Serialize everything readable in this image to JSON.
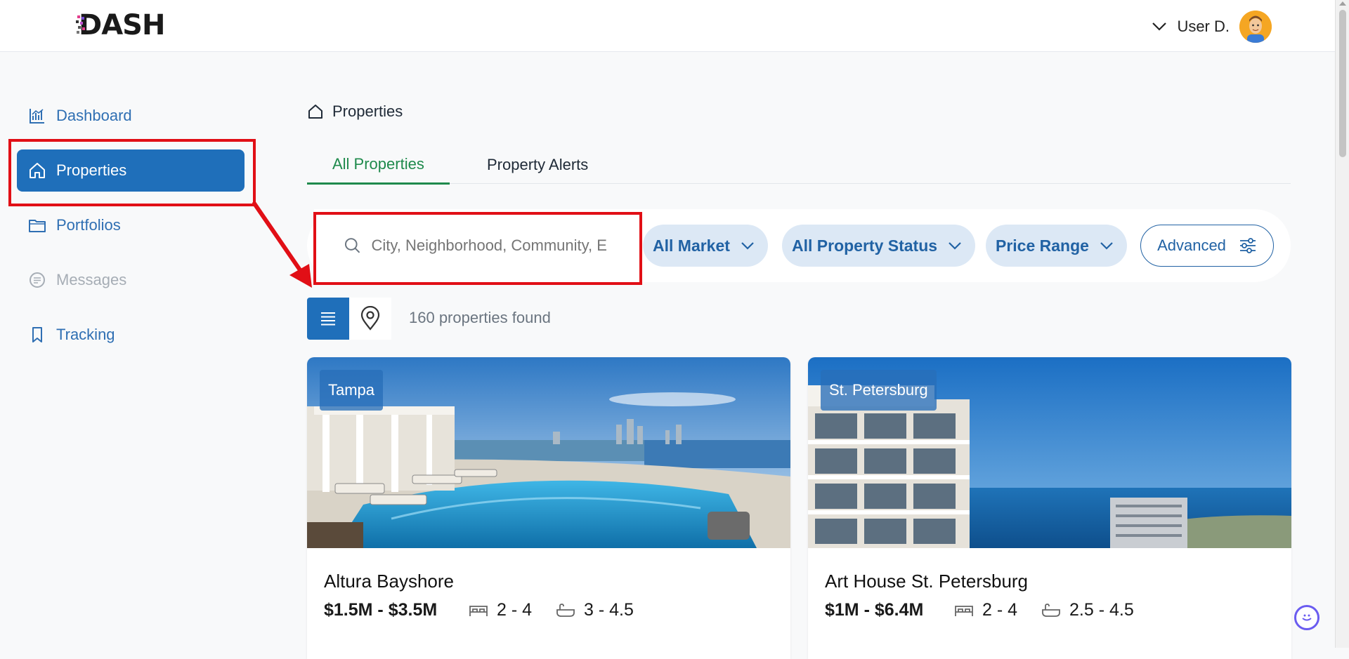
{
  "header": {
    "logo_text": "DASH",
    "user_name": "User D."
  },
  "sidebar": {
    "items": [
      {
        "label": "Dashboard",
        "icon": "chart-icon",
        "state": "normal"
      },
      {
        "label": "Properties",
        "icon": "home-icon",
        "state": "active"
      },
      {
        "label": "Portfolios",
        "icon": "folder-icon",
        "state": "normal"
      },
      {
        "label": "Messages",
        "icon": "message-icon",
        "state": "disabled"
      },
      {
        "label": "Tracking",
        "icon": "bookmark-icon",
        "state": "normal"
      }
    ]
  },
  "breadcrumb": {
    "label": "Properties"
  },
  "tabs": [
    {
      "label": "All Properties",
      "active": true
    },
    {
      "label": "Property Alerts",
      "active": false
    }
  ],
  "filters": {
    "search_placeholder": "City, Neighborhood, Community, E",
    "market_label": "All Market",
    "status_label": "All Property Status",
    "price_label": "Price Range",
    "advanced_label": "Advanced"
  },
  "results": {
    "count_text": "160 properties found"
  },
  "cards": [
    {
      "location": "Tampa",
      "title": "Altura Bayshore",
      "price": "$1.5M - $3.5M",
      "beds": "2 - 4",
      "baths": "3 - 4.5"
    },
    {
      "location": "St. Petersburg",
      "title": "Art House St. Petersburg",
      "price": "$1M - $6.4M",
      "beds": "2 - 4",
      "baths": "2.5 - 4.5"
    }
  ],
  "colors": {
    "primary": "#1f6fba",
    "active_tab": "#1f8a4c",
    "pill_bg": "#dce8f5",
    "annotation": "#e10f16"
  }
}
